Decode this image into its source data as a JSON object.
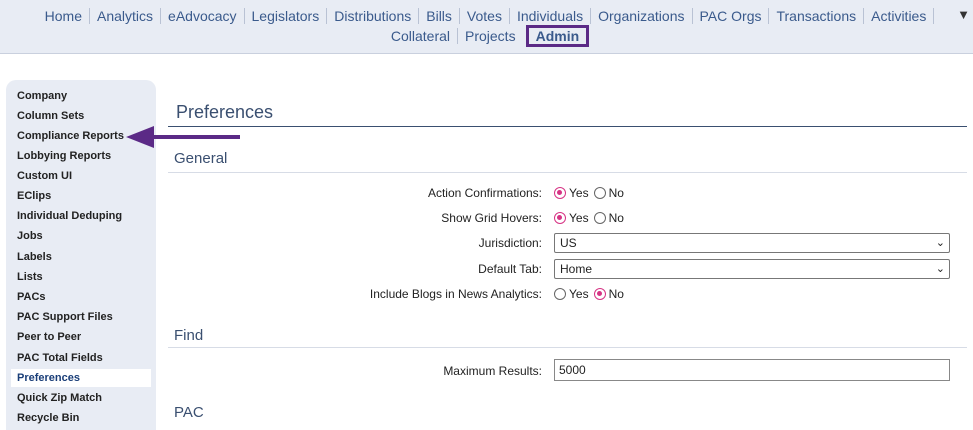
{
  "nav": {
    "row1": [
      "Home",
      "Analytics",
      "eAdvocacy",
      "Legislators",
      "Distributions",
      "Bills",
      "Votes",
      "Individuals",
      "Organizations",
      "PAC Orgs",
      "Transactions",
      "Activities"
    ],
    "row2": [
      "Collateral",
      "Projects"
    ],
    "active": "Admin",
    "collapse_icon": "▼"
  },
  "sidebar": {
    "items": [
      "Company",
      "Column Sets",
      "Compliance Reports",
      "Lobbying Reports",
      "Custom UI",
      "EClips",
      "Individual Deduping",
      "Jobs",
      "Labels",
      "Lists",
      "PACs",
      "PAC Support Files",
      "Peer to Peer",
      "PAC Total Fields",
      "Preferences",
      "Quick Zip Match",
      "Recycle Bin"
    ],
    "active": "Preferences"
  },
  "main": {
    "title": "Preferences",
    "general": {
      "heading": "General",
      "action_confirmations": {
        "label": "Action Confirmations:",
        "yes": "Yes",
        "no": "No",
        "value": "Yes"
      },
      "show_grid_hovers": {
        "label": "Show Grid Hovers:",
        "yes": "Yes",
        "no": "No",
        "value": "Yes"
      },
      "jurisdiction": {
        "label": "Jurisdiction:",
        "value": "US"
      },
      "default_tab": {
        "label": "Default Tab:",
        "value": "Home"
      },
      "include_blogs": {
        "label": "Include Blogs in News Analytics:",
        "yes": "Yes",
        "no": "No",
        "value": "No"
      }
    },
    "find": {
      "heading": "Find",
      "max_results": {
        "label": "Maximum Results:",
        "value": "5000"
      }
    },
    "pac": {
      "heading": "PAC"
    }
  },
  "colors": {
    "accent": "#5b2a86",
    "link": "#3a5a8c",
    "radio": "#d63384"
  }
}
